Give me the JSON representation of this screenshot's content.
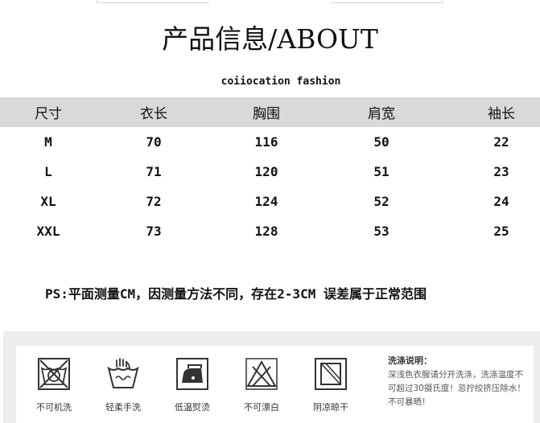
{
  "title": "产品信息/ABOUT",
  "brand": "coiiocation fashion",
  "size_table": {
    "headers": [
      "尺寸",
      "衣长",
      "胸围",
      "肩宽",
      "袖长"
    ],
    "rows": [
      [
        "M",
        "70",
        "116",
        "50",
        "22"
      ],
      [
        "L",
        "71",
        "120",
        "51",
        "23"
      ],
      [
        "XL",
        "72",
        "124",
        "52",
        "24"
      ],
      [
        "XXL",
        "73",
        "128",
        "53",
        "25"
      ]
    ]
  },
  "note": "PS:平面测量CM，因测量方法不同，存在2-3CM 误差属于正常范围",
  "care": {
    "items": [
      {
        "label": "不可机洗",
        "icon": "no-machine-wash-icon"
      },
      {
        "label": "轻柔手洗",
        "icon": "hand-wash-icon"
      },
      {
        "label": "低温熨烫",
        "icon": "low-iron-icon"
      },
      {
        "label": "不可漂白",
        "icon": "no-bleach-icon"
      },
      {
        "label": "阴凉晾干",
        "icon": "shade-dry-icon"
      }
    ],
    "instructions_title": "洗涤说明：",
    "instructions_text": "深浅色衣服请分开洗涤，洗涤温度不可超过30摄氏度！忌拧绞挤压除水！不可暴晒！"
  }
}
